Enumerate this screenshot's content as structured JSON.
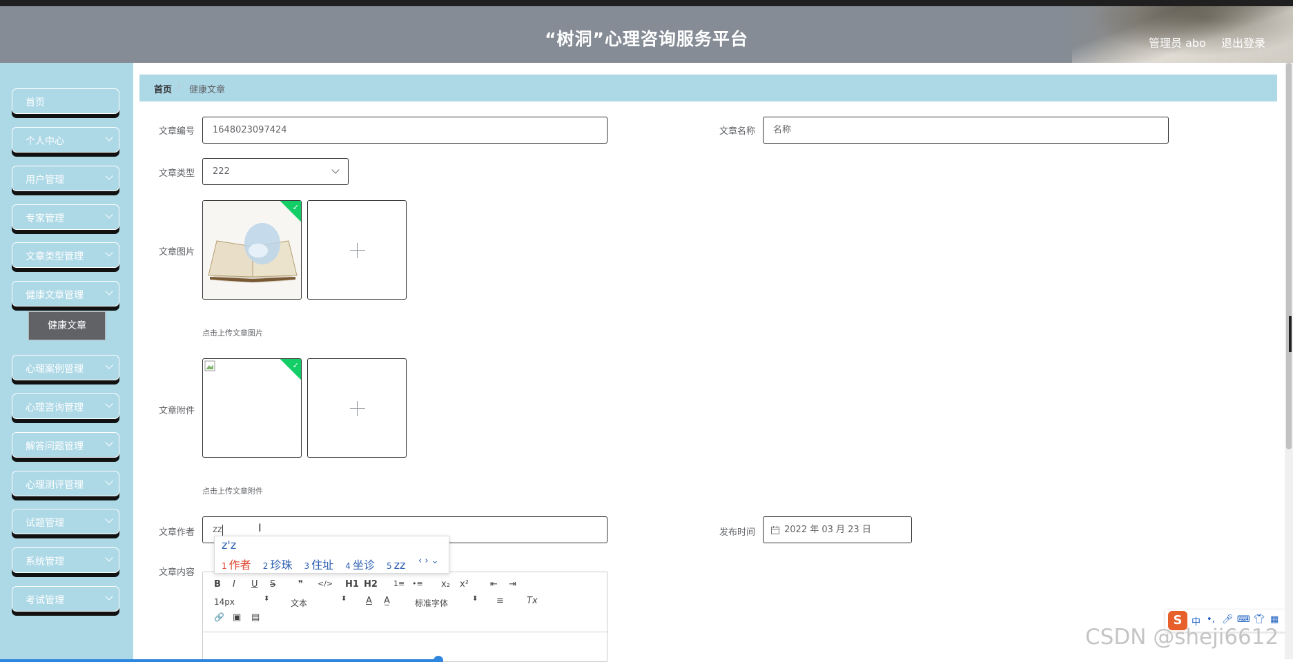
{
  "header": {
    "title": "“树洞”心理咨询服务平台",
    "user": "管理员 abo",
    "logout": "退出登录"
  },
  "sidebar": {
    "items": [
      {
        "label": "首页"
      },
      {
        "label": "个人中心"
      },
      {
        "label": "用户管理"
      },
      {
        "label": "专家管理"
      },
      {
        "label": "文章类型管理"
      },
      {
        "label": "健康文章管理"
      },
      {
        "label": "心理案例管理"
      },
      {
        "label": "心理咨询管理"
      },
      {
        "label": "解答问题管理"
      },
      {
        "label": "心理测评管理"
      },
      {
        "label": "试题管理"
      },
      {
        "label": "系统管理"
      },
      {
        "label": "考试管理"
      }
    ],
    "active_sub": "健康文章"
  },
  "breadcrumb": {
    "home": "首页",
    "sep": "/",
    "current": "健康文章"
  },
  "form": {
    "article_no_label": "文章编号",
    "article_no_value": "1648023097424",
    "article_name_label": "文章名称",
    "article_name_placeholder": "名称",
    "article_type_label": "文章类型",
    "article_type_value": "222",
    "article_image_label": "文章图片",
    "article_image_hint": "点击上传文章图片",
    "article_attach_label": "文章附件",
    "article_attach_hint": "点击上传文章附件",
    "author_label": "文章作者",
    "author_value": "zz",
    "publish_label": "发布时间",
    "publish_value": "2022 年 03 月 23 日",
    "content_label": "文章内容"
  },
  "ime": {
    "pinyin": "z'z",
    "candidates": [
      {
        "n": "1",
        "text": "作者"
      },
      {
        "n": "2",
        "text": "珍珠"
      },
      {
        "n": "3",
        "text": "住址"
      },
      {
        "n": "4",
        "text": "坐诊"
      },
      {
        "n": "5",
        "text": "zz"
      }
    ]
  },
  "editor": {
    "font_size": "14px",
    "text_style": "文本",
    "font_family": "标准字体",
    "tools": [
      "B",
      "I",
      "U",
      "S",
      "❞",
      "</>",
      "H1",
      "H2",
      "1≡",
      "•≡",
      "x₂",
      "x²",
      "⇤",
      "⇥",
      "A",
      "A̲",
      "≡",
      "Tx",
      "🔗",
      "▣",
      "▤"
    ]
  },
  "watermark": "CSDN @sheji6612",
  "ime_bar": {
    "logo": "S",
    "lang": "中"
  }
}
